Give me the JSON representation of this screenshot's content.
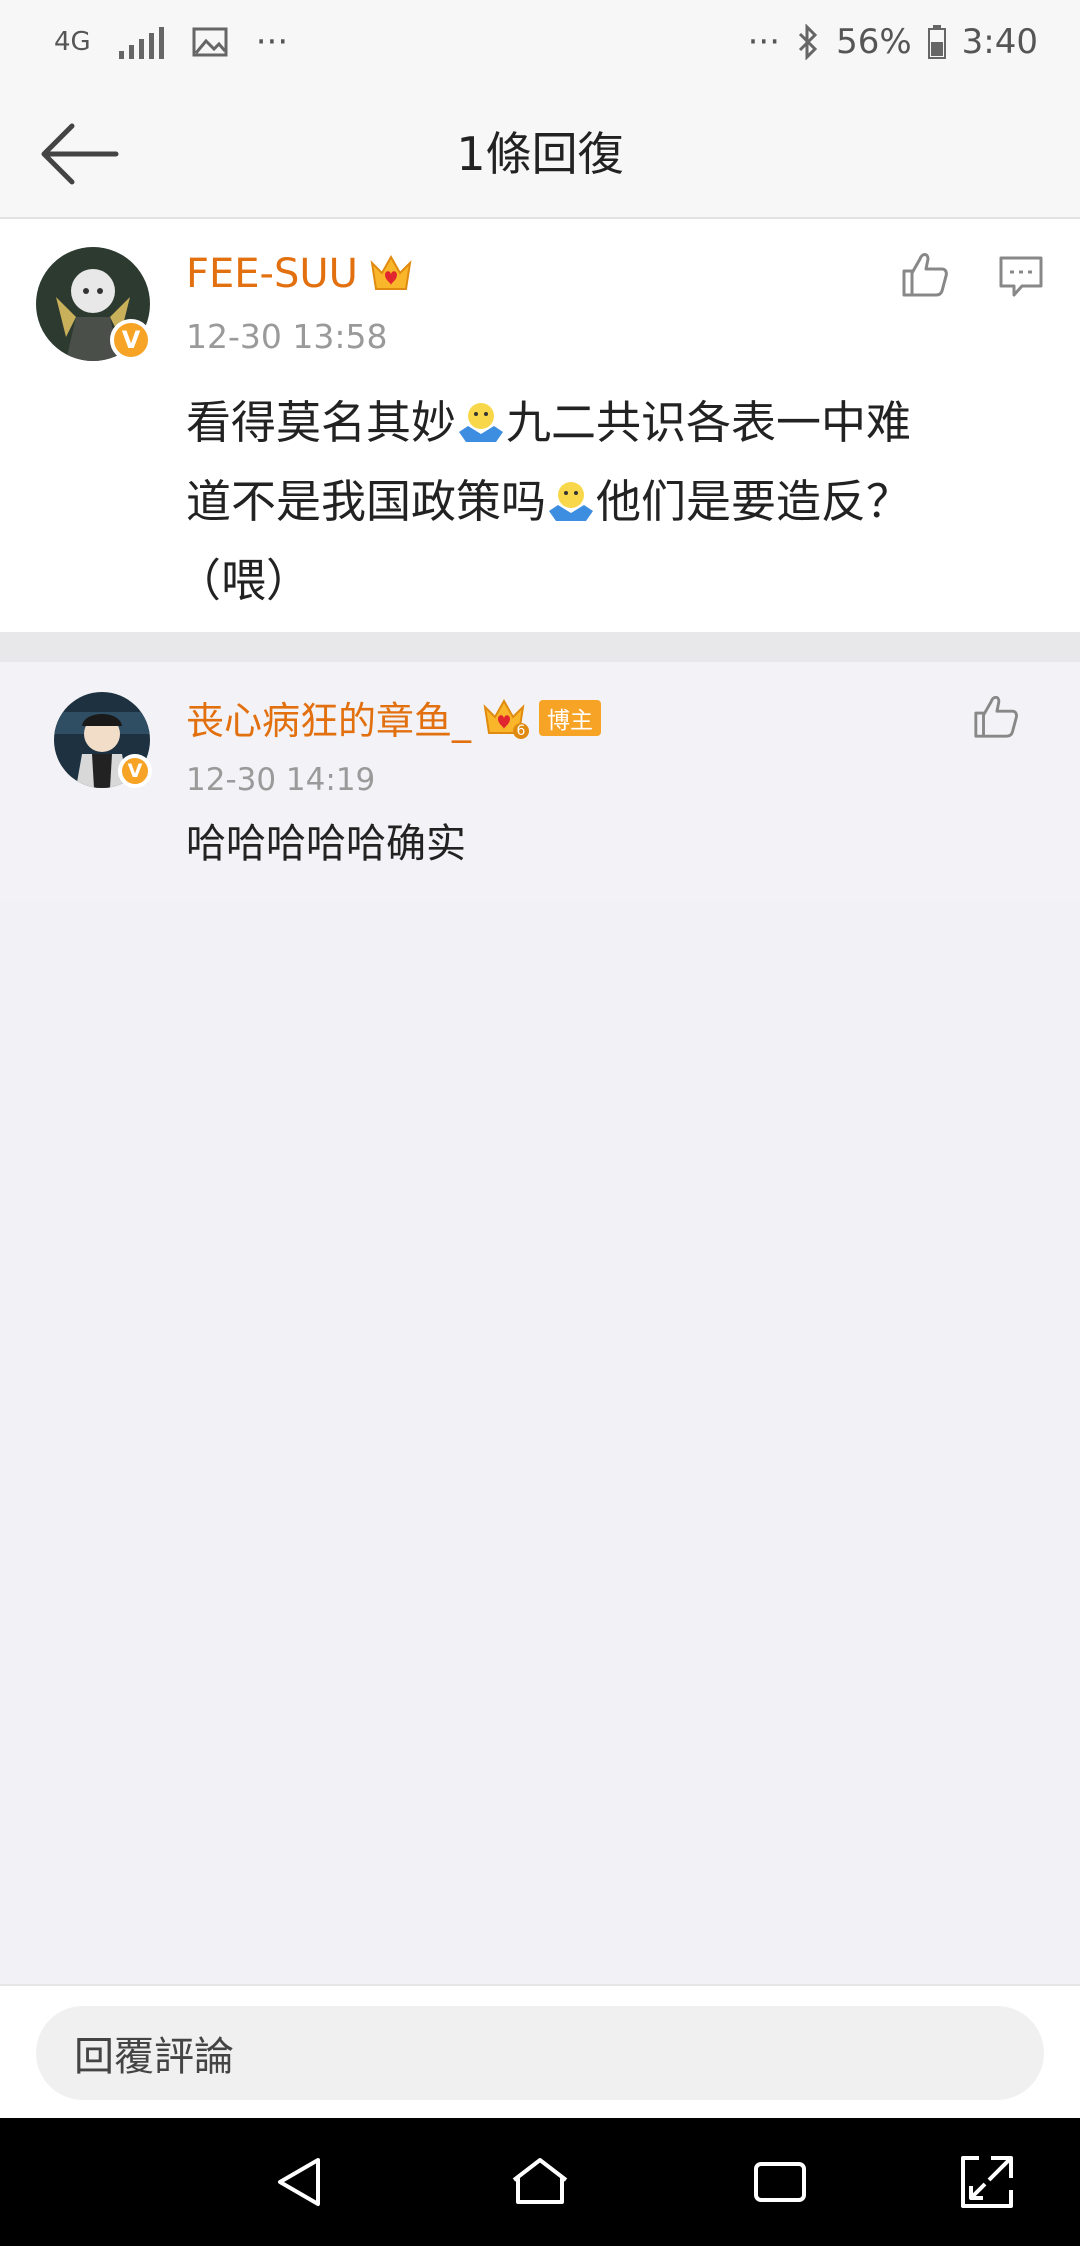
{
  "status_bar": {
    "network": "4G",
    "left_more": "···",
    "right_more": "···",
    "battery": "56%",
    "time": "3:40"
  },
  "header": {
    "title": "1條回復"
  },
  "main_comment": {
    "username": "FEE-SUU",
    "verified_mark": "V",
    "timestamp": "12-30 13:58",
    "text_part1": "看得莫名其妙",
    "text_part2": "九二共识各表一中难",
    "text_part3": "道不是我国政策吗",
    "text_part4": "他们是要造反？",
    "text_part5": "（喂）"
  },
  "reply": {
    "username": "丧心病狂的章鱼_",
    "verified_mark": "V",
    "crown_level": "6",
    "badge": "博主",
    "timestamp": "12-30 14:19",
    "text": "哈哈哈哈哈确实"
  },
  "bottom_bar": {
    "input_placeholder": "回覆評論"
  },
  "colors": {
    "username": "#e2700f",
    "badge": "#f7a325",
    "timestamp": "#9a9a9a"
  },
  "icons": [
    "back-arrow-icon",
    "like-icon",
    "comment-icon",
    "shrug-emoji-icon",
    "crown-icon",
    "signal-icon",
    "image-icon",
    "bluetooth-icon",
    "battery-icon",
    "nav-back-icon",
    "nav-home-icon",
    "nav-recents-icon",
    "nav-expand-icon"
  ]
}
